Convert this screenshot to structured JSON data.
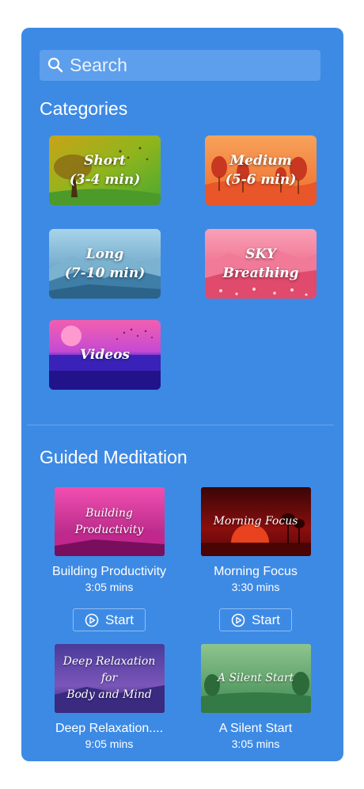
{
  "search": {
    "placeholder": "Search"
  },
  "categories": {
    "title": "Categories",
    "items": [
      {
        "line1": "Short",
        "line2": "(3-4 min)"
      },
      {
        "line1": "Medium",
        "line2": "(5-6 min)"
      },
      {
        "line1": "Long",
        "line2": "(7-10 min)"
      },
      {
        "line1": "SKY",
        "line2": "Breathing"
      },
      {
        "line1": "Videos",
        "line2": ""
      }
    ]
  },
  "guided": {
    "title": "Guided Meditation",
    "start_label": "Start",
    "items": [
      {
        "thumb_lines": [
          "Building",
          "Productivity"
        ],
        "name": "Building Productivity",
        "duration": "3:05 mins"
      },
      {
        "thumb_lines": [
          "Morning Focus"
        ],
        "name": "Morning Focus",
        "duration": "3:30 mins"
      },
      {
        "thumb_lines": [
          "Deep Relaxation",
          "for",
          "Body and Mind"
        ],
        "name": "Deep Relaxation....",
        "duration": "9:05 mins"
      },
      {
        "thumb_lines": [
          "A Silent Start"
        ],
        "name": "A Silent Start",
        "duration": "3:05 mins"
      }
    ]
  },
  "colors": {
    "panel": "#3d8ae5",
    "search_bg": "#5d9fec",
    "text": "#ffffff"
  },
  "icons": {
    "search": "search-icon",
    "play": "play-circle-icon"
  }
}
